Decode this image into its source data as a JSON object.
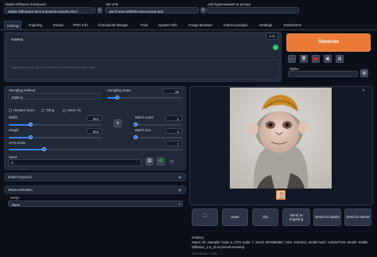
{
  "header": {
    "checkpoint_label": "Stable Diffusion checkpoint",
    "checkpoint_value": "Stable Diffusion/1.5/v1-5-pruned-emaonly.ckpt [",
    "vae_label": "SD VAE",
    "vae_value": "vae-ft-mse-840000-ema-pruned.ckpt",
    "hypernet_label": "Add hypernetwork to prompt"
  },
  "tabs": [
    "txt2img",
    "img2img",
    "Extras",
    "PNG Info",
    "Checkpoint Merger",
    "Train",
    "System Info",
    "Image Browser",
    "Instruct-pix2pix",
    "Settings",
    "Extensions"
  ],
  "prompt": {
    "text": "monkey",
    "counter": "1/75",
    "negative_placeholder": "Negative prompt (press Ctrl+Enter or Alt+Enter to generate)"
  },
  "generate_label": "Generate",
  "styles_label": "Styles",
  "tool_icons": [
    "arrow-icon",
    "trash-icon",
    "red-square-icon",
    "save-icon",
    "clipboard-icon"
  ],
  "sampling": {
    "method_label": "Sampling method",
    "method_value": "Euler a",
    "steps_label": "Sampling steps",
    "steps_value": "20",
    "steps_fraction": 0.13
  },
  "checks": {
    "restore_faces": "Restore faces",
    "tiling": "Tiling",
    "hires_fix": "Hires. fix"
  },
  "dims": {
    "width_label": "Width",
    "width_value": "512",
    "width_fraction": 0.22,
    "height_label": "Height",
    "height_value": "512",
    "height_fraction": 0.22
  },
  "batch": {
    "count_label": "Batch count",
    "count_value": "1",
    "size_label": "Batch size",
    "size_value": "1"
  },
  "cfg": {
    "label": "CFG Scale",
    "value": "7",
    "fraction": 0.2
  },
  "seed": {
    "label": "Seed",
    "value": "-1"
  },
  "accordions": {
    "model_keyword": "Model Keyword",
    "steps_animation": "Steps animation",
    "script_label": "Script",
    "script_value": "None"
  },
  "output_buttons": [
    "Save",
    "Zip",
    "Send to img2img",
    "Send to inpaint",
    "Send to extras"
  ],
  "output_info": {
    "prompt": "monkey",
    "params": "Steps: 20, Sampler: Euler a, CFG scale: 7, Seed: 3075584657, Size: 512x512, Model hash: cc6cb27103, Model: Stable Diffusion_1.5_v1-5-pruned-emaonly",
    "time": "Time taken: 1.20s"
  }
}
